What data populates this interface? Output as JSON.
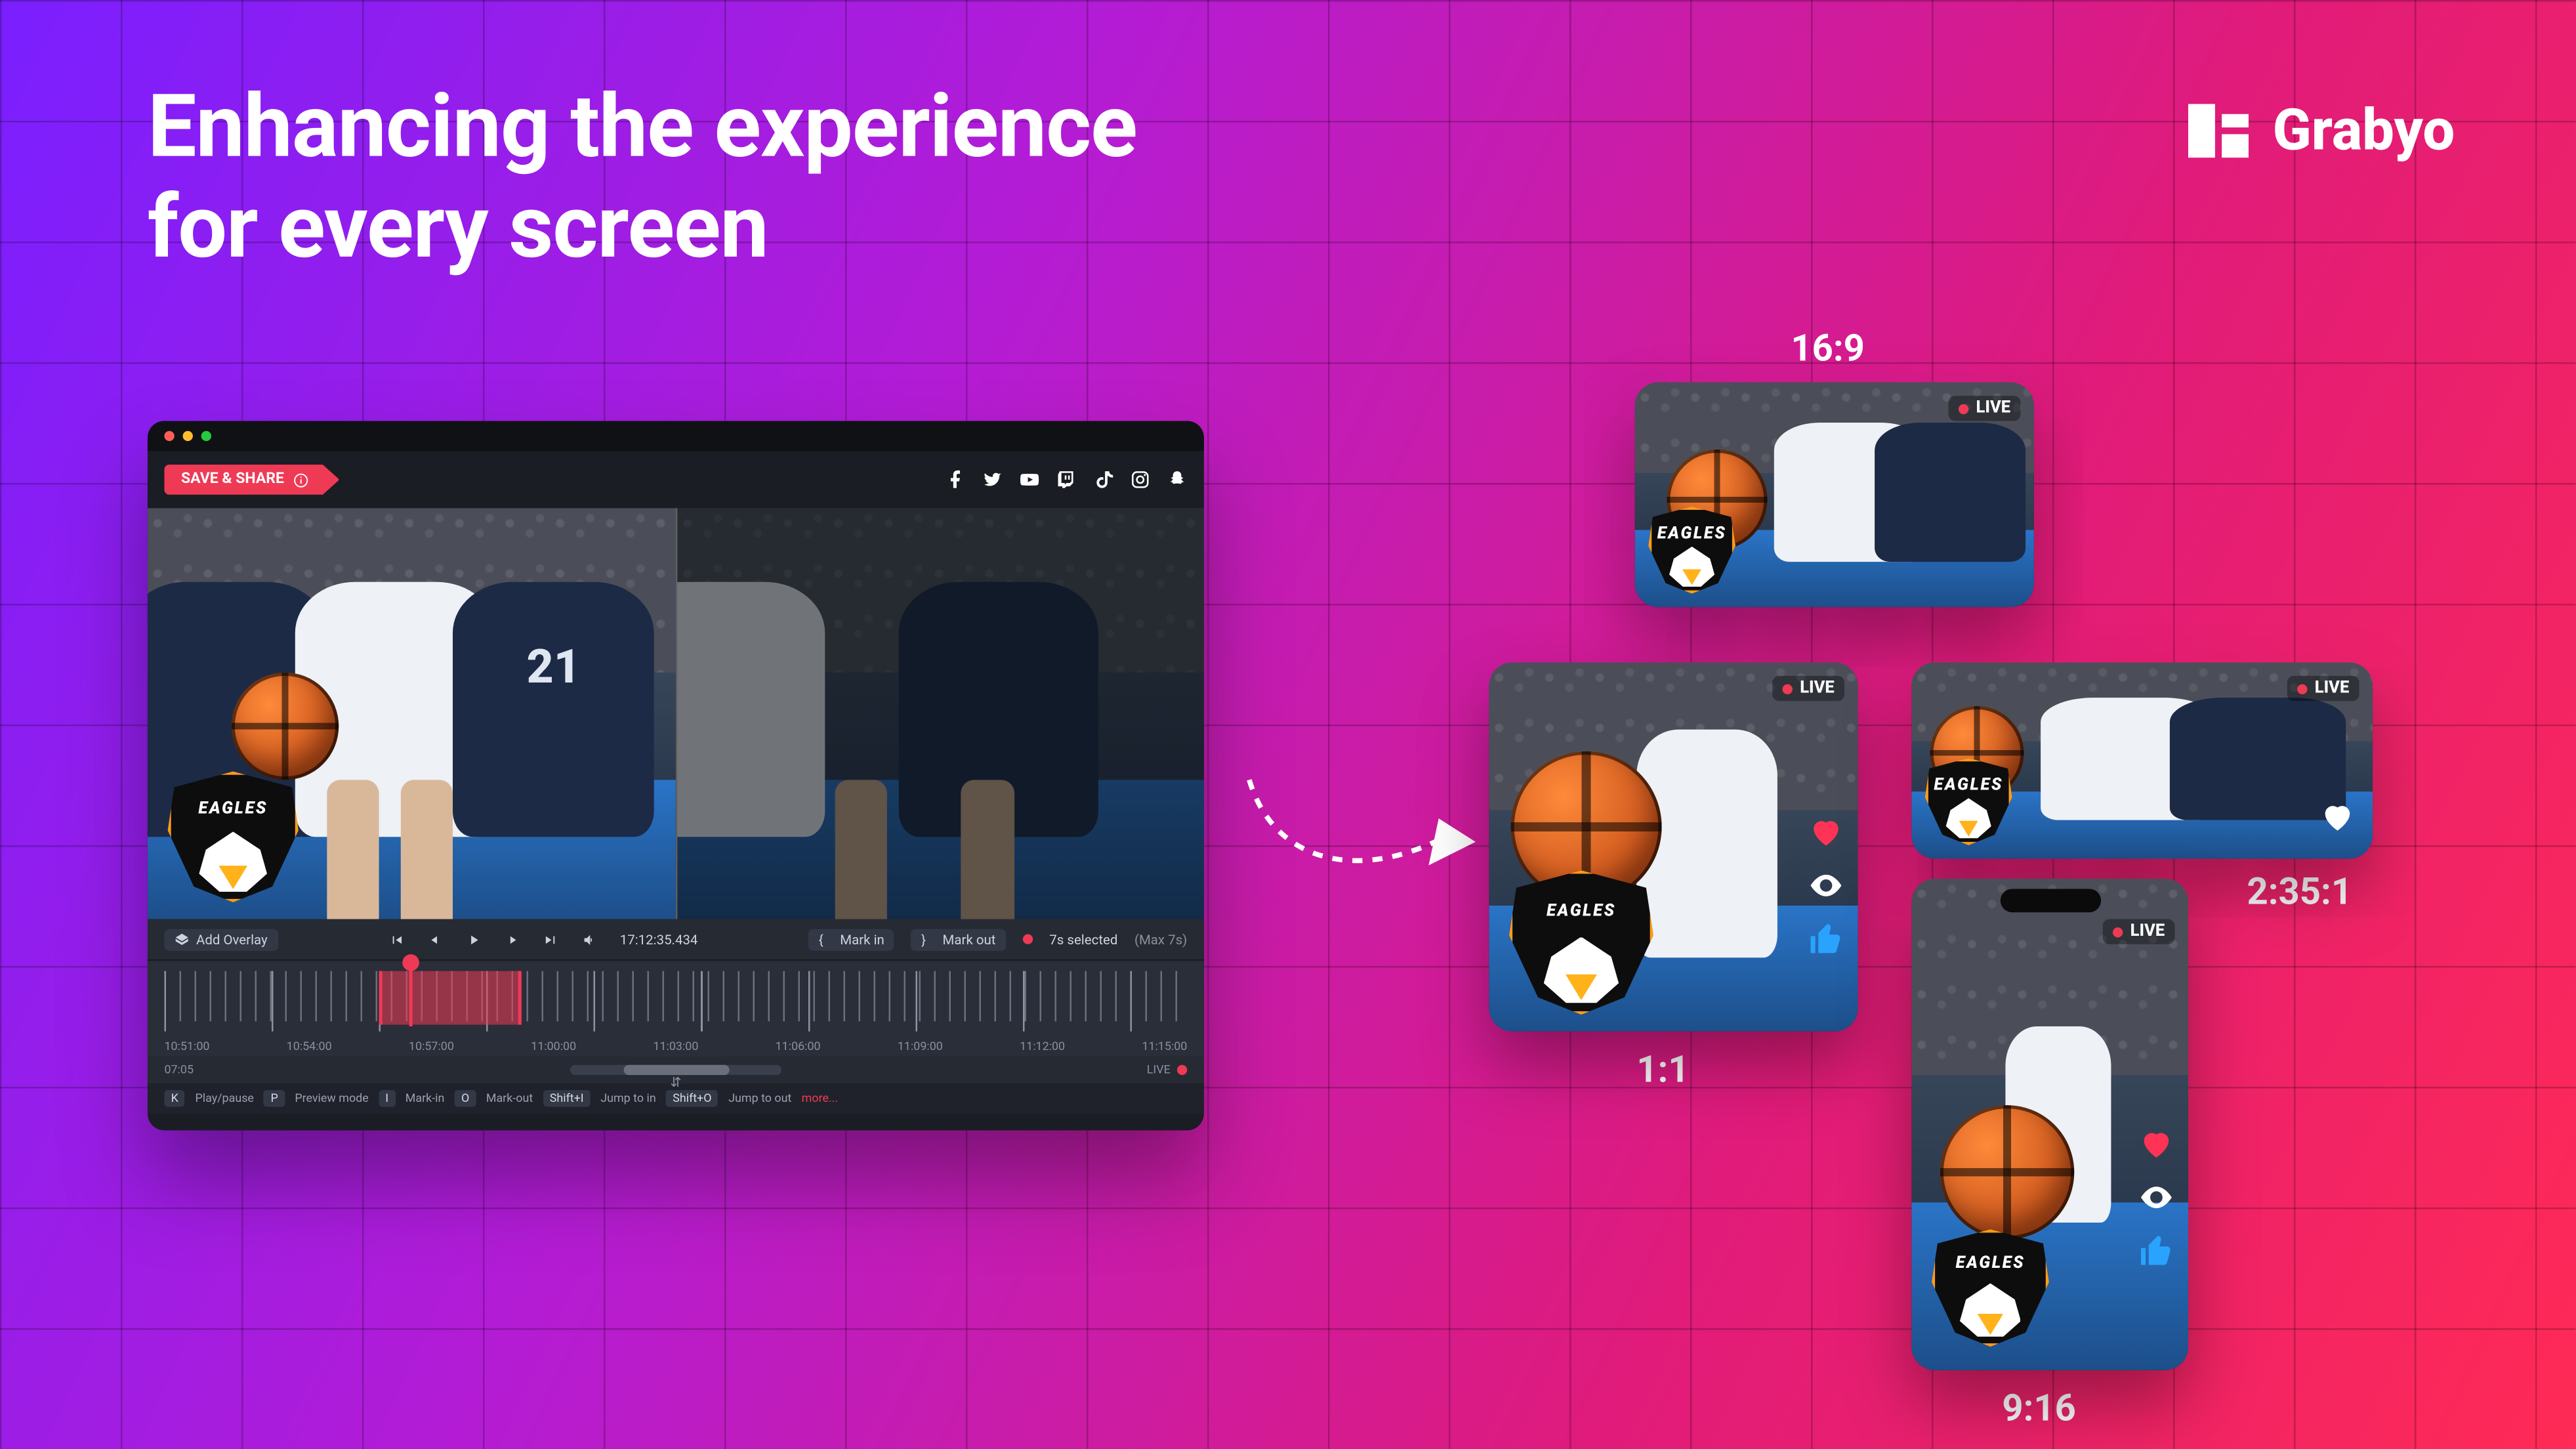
{
  "headline": {
    "line1": "Enhancing the experience",
    "line2": "for every screen"
  },
  "brand": {
    "name": "Grabyo"
  },
  "editor": {
    "save_share_label": "SAVE & SHARE",
    "share_targets": [
      "facebook",
      "twitter",
      "youtube",
      "twitch",
      "tiktok",
      "instagram",
      "snapchat"
    ],
    "jersey_number": "21",
    "team_logo_text": "EAGLES",
    "controls": {
      "add_overlay": "Add Overlay",
      "mark_in": "Mark in",
      "mark_out": "Mark out",
      "selected_text": "7s selected",
      "selected_max": "(Max 7s)",
      "timecode": "17:12:35.434"
    },
    "timeline": {
      "labels": [
        "10:51:00",
        "10:54:00",
        "10:57:00",
        "11:00:00",
        "11:03:00",
        "11:06:00",
        "11:09:00",
        "11:12:00",
        "11:15:00"
      ],
      "left_time": "07:05",
      "live_label": "LIVE",
      "selection_start_pct": 21,
      "selection_end_pct": 35,
      "playhead_pct": 24
    },
    "shortcuts": {
      "k": "K",
      "k_label": "Play/pause",
      "p": "P",
      "p_label": "Preview mode",
      "i": "I",
      "i_label": "Mark-in",
      "o": "O",
      "o_label": "Mark-out",
      "shift_i": "Shift+I",
      "shift_i_label": "Jump to in",
      "shift_o": "Shift+O",
      "shift_o_label": "Jump to out",
      "more": "more..."
    }
  },
  "previews": {
    "live_label": "LIVE",
    "ratios": {
      "r169": "16:9",
      "r11": "1:1",
      "r235": "2:35:1",
      "r916": "9:16"
    }
  }
}
